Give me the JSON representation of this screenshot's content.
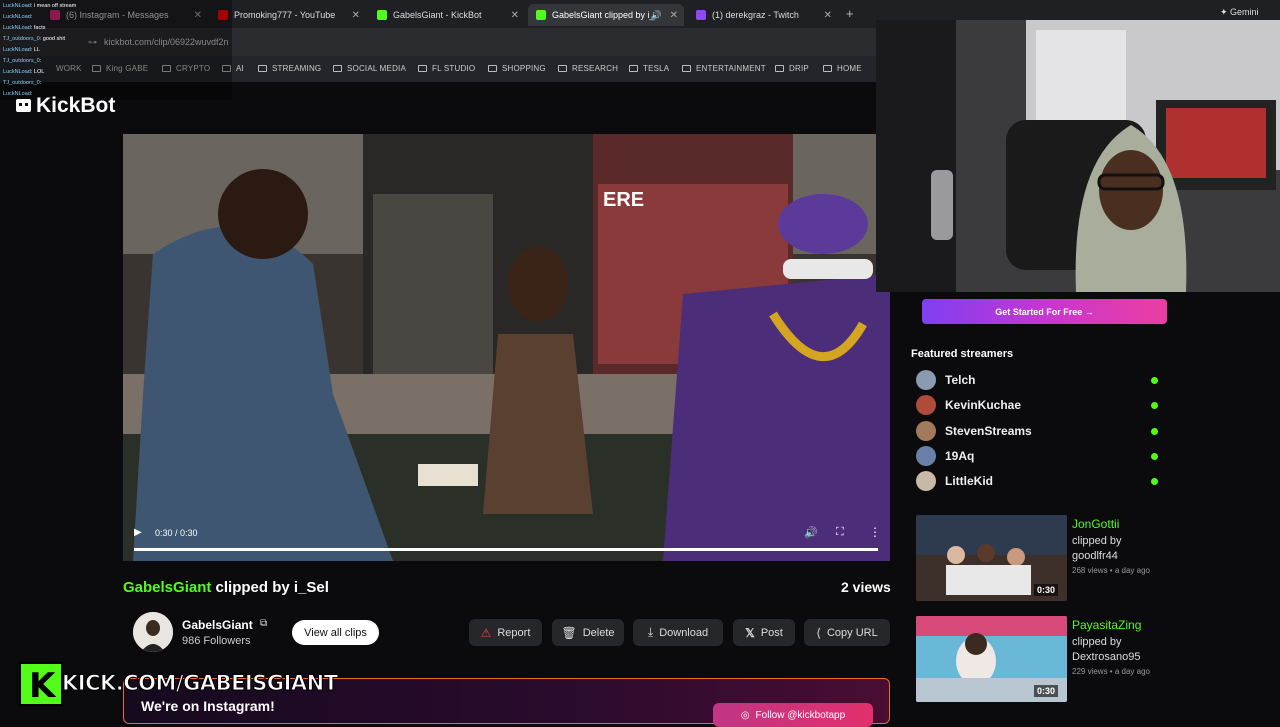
{
  "browser": {
    "tabs": [
      {
        "label": "(6) Instagram - Messages",
        "color": "#d62976"
      },
      {
        "label": "Promoking777 - YouTube",
        "color": "#ff0000"
      },
      {
        "label": "GabelsGiant - KickBot",
        "color": "#53fc18"
      },
      {
        "label": "GabelsGiant clipped by i_",
        "color": "#53fc18"
      },
      {
        "label": "(1) derekgraz - Twitch",
        "color": "#9146ff"
      }
    ],
    "new_tab": "+",
    "gemini": "Gemini",
    "url": "kickbot.com/clip/06922wuvdf2n",
    "bookmarks": [
      "WORK",
      "King GABE",
      "CRYPTO",
      "AI",
      "STREAMING",
      "SOCIAL MEDIA",
      "FL STUDIO",
      "SHOPPING",
      "RESEARCH",
      "TESLA",
      "ENTERTAINMENT",
      "DRIP",
      "HOME"
    ]
  },
  "chat": [
    {
      "user": "LuckNLoad",
      "msg": ": i mean off stream"
    },
    {
      "user": "LuckNLoad",
      "msg": ":"
    },
    {
      "user": "LuckNLoad",
      "msg": ": facts"
    },
    {
      "user": "TJ_outdoors_0",
      "msg": ": good shit"
    },
    {
      "user": "LuckNLoad",
      "msg": ": LL"
    },
    {
      "user": "TJ_outdoors_0",
      "msg": ":"
    },
    {
      "user": "LuckNLoad",
      "msg": ": LOL"
    },
    {
      "user": "TJ_outdoors_0",
      "msg": ":"
    },
    {
      "user": "LuckNLoad",
      "msg": ":"
    }
  ],
  "site": {
    "logo": "KickBot"
  },
  "video": {
    "time": "0:30 / 0:30",
    "progress": 1.0,
    "sign_text": "ERE"
  },
  "clip": {
    "channel": "GabelsGiant",
    "clipped_by": " clipped by i_Sel",
    "views": "2 views",
    "followers": "986 Followers",
    "view_all": "View all clips",
    "actions": {
      "report": "Report",
      "delete": "Delete",
      "download": "Download",
      "post": "Post",
      "copy_url": "Copy URL"
    }
  },
  "promo": {
    "text": "We're on Instagram!",
    "follow": "Follow @kickbotapp"
  },
  "overlay": {
    "k": "K",
    "url": "KICK.COM/GABEISGIANT"
  },
  "sidebar": {
    "cta": "Get Started For Free →",
    "featured_title": "Featured streamers",
    "streamers": [
      {
        "name": "Telch",
        "color": "#8a9bb0"
      },
      {
        "name": "KevinKuchae",
        "color": "#b04a3a"
      },
      {
        "name": "StevenStreams",
        "color": "#a07a5a"
      },
      {
        "name": "19Aq",
        "color": "#6a7fa8"
      },
      {
        "name": "LittleKid",
        "color": "#c8b8a6"
      }
    ],
    "clips": [
      {
        "name": "JonGottii",
        "clipped_by": "clipped by",
        "clipper": "goodlfr44",
        "meta": "268 views • a day ago",
        "duration": "0:30"
      },
      {
        "name": "PayasitaZing",
        "clipped_by": "clipped by",
        "clipper": "Dextrosano95",
        "meta": "229 views • a day ago",
        "duration": "0:30"
      }
    ]
  }
}
